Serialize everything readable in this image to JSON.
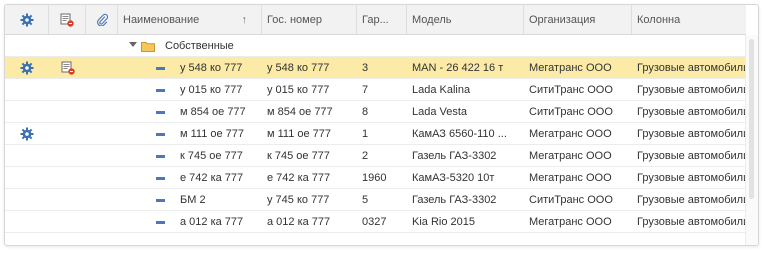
{
  "columns": {
    "name": "Наименование",
    "gos_number": "Гос. номер",
    "garage": "Гар...",
    "model": "Модель",
    "organization": "Организация",
    "column": "Колонна"
  },
  "sort_indicator": "↑",
  "group": {
    "label": "Собственные",
    "expanded": true
  },
  "rows": [
    {
      "name": "у 548 ко 777",
      "gos_number": "у 548 ко 777",
      "garage": "3",
      "model": "MAN - 26 422  16 т",
      "organization": "Мегатранс ООО",
      "column": "Грузовые автомобили",
      "selected": true,
      "gear_icon": true,
      "doc_icon": true
    },
    {
      "name": "у 015 ко 777",
      "gos_number": "у 015 ко 777",
      "garage": "7",
      "model": "Lada Kalina",
      "organization": "СитиТранс ООО",
      "column": "Грузовые автомобили"
    },
    {
      "name": "м 854 ое 777",
      "gos_number": "м 854 ое 777",
      "garage": "8",
      "model": "Lada Vesta",
      "organization": "СитиТранс ООО",
      "column": "Грузовые автомобили"
    },
    {
      "name": "м 111 ое 777",
      "gos_number": "м 111 ое 777",
      "garage": "1",
      "model": "КамАЗ 6560-110 ...",
      "organization": "Мегатранс ООО",
      "column": "Грузовые автомобили",
      "gear_icon": true
    },
    {
      "name": "к 745 ое 777",
      "gos_number": "к 745 ое 777",
      "garage": "2",
      "model": "Газель ГАЗ-3302",
      "organization": "Мегатранс ООО",
      "column": "Грузовые автомобили"
    },
    {
      "name": "е 742 ка 777",
      "gos_number": "е 742 ка 777",
      "garage": "1960",
      "model": "КамАЗ-5320 10т",
      "organization": "Мегатранс ООО",
      "column": "Грузовые автомобили"
    },
    {
      "name": "БМ 2",
      "gos_number": "у 745 ко 777",
      "garage": "5",
      "model": "Газель ГАЗ-3302",
      "organization": "СитиТранс ООО",
      "column": "Грузовые автомобили"
    },
    {
      "name": "а 012 ка 777",
      "gos_number": "а 012 ка 777",
      "garage": "0327",
      "model": "Kia Rio 2015",
      "organization": "Мегатранс ООО",
      "column": "Грузовые автомобили"
    }
  ],
  "colors": {
    "selected_row": "#fbeba6",
    "header_bg": "#f2f2f2",
    "gear_blue": "#3a6fb0",
    "doc_red": "#d9402b"
  }
}
